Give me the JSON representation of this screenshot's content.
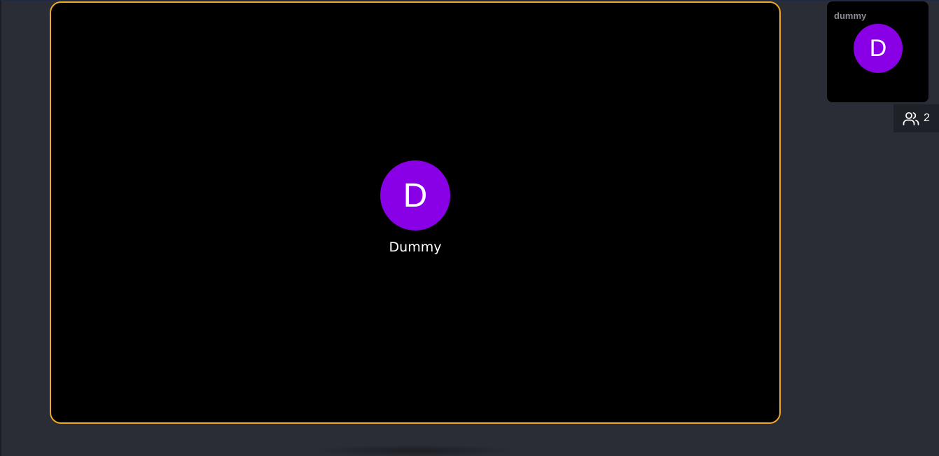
{
  "main_stage": {
    "participant": {
      "initial": "D",
      "name": "Dummy",
      "avatar_color": "#8a00e6"
    },
    "active_speaker_border_color": "#f0a726"
  },
  "sidebar": {
    "tiles": [
      {
        "label": "dummy",
        "initial": "D",
        "avatar_color": "#8a00e6"
      }
    ]
  },
  "participants_button": {
    "icon": "people-icon",
    "count": "2"
  }
}
